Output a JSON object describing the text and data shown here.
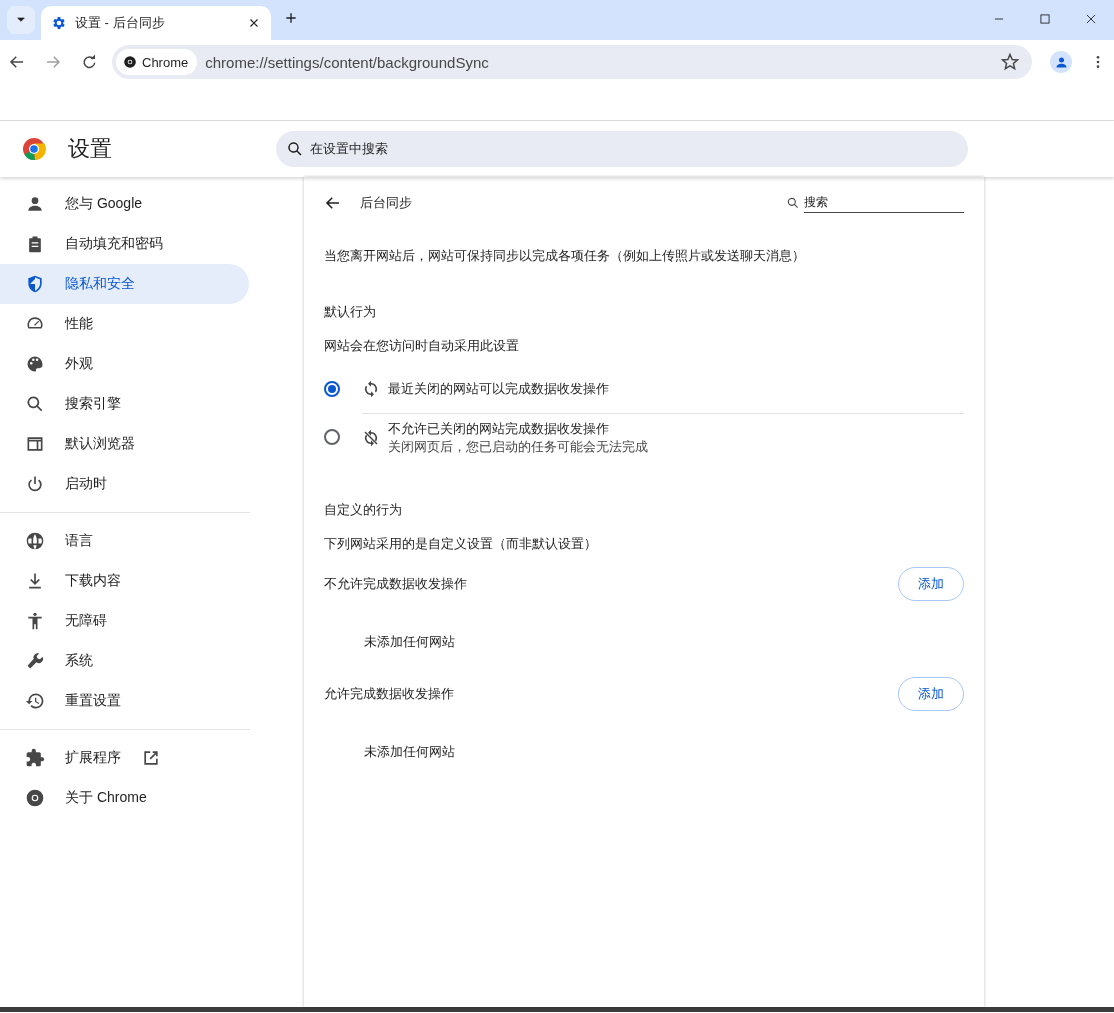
{
  "browser": {
    "tab": {
      "title": "设置 - 后台同步"
    },
    "chip": "Chrome",
    "url": "chrome://settings/content/backgroundSync"
  },
  "header": {
    "title": "设置",
    "search": {
      "placeholder": "在设置中搜索"
    }
  },
  "sidebar": {
    "groups": [
      [
        {
          "label": "您与 Google",
          "selected": false
        },
        {
          "label": "自动填充和密码",
          "selected": false
        },
        {
          "label": "隐私和安全",
          "selected": true
        },
        {
          "label": "性能",
          "selected": false
        },
        {
          "label": "外观",
          "selected": false
        },
        {
          "label": "搜索引擎",
          "selected": false
        },
        {
          "label": "默认浏览器",
          "selected": false
        },
        {
          "label": "启动时",
          "selected": false
        }
      ],
      [
        {
          "label": "语言",
          "selected": false
        },
        {
          "label": "下载内容",
          "selected": false
        },
        {
          "label": "无障碍",
          "selected": false
        },
        {
          "label": "系统",
          "selected": false
        },
        {
          "label": "重置设置",
          "selected": false
        }
      ],
      [
        {
          "label": "扩展程序",
          "selected": false
        },
        {
          "label": "关于 Chrome",
          "selected": false
        }
      ]
    ]
  },
  "page": {
    "title": "后台同步",
    "search": {
      "placeholder": "搜索"
    },
    "description": "当您离开网站后，网站可保持同步以完成各项任务（例如上传照片或发送聊天消息）",
    "default": {
      "heading": "默认行为",
      "subheading": "网站会在您访问时自动采用此设置",
      "options": [
        {
          "label": "最近关闭的网站可以完成数据收发操作",
          "selected": true
        },
        {
          "label": "不允许已关闭的网站完成数据收发操作",
          "sublabel": "关闭网页后，您已启动的任务可能会无法完成",
          "selected": false
        }
      ]
    },
    "custom": {
      "heading": "自定义的行为",
      "subheading": "下列网站采用的是自定义设置（而非默认设置）",
      "lists": [
        {
          "title": "不允许完成数据收发操作",
          "button": "添加",
          "empty": "未添加任何网站"
        },
        {
          "title": "允许完成数据收发操作",
          "button": "添加",
          "empty": "未添加任何网站"
        }
      ]
    }
  }
}
